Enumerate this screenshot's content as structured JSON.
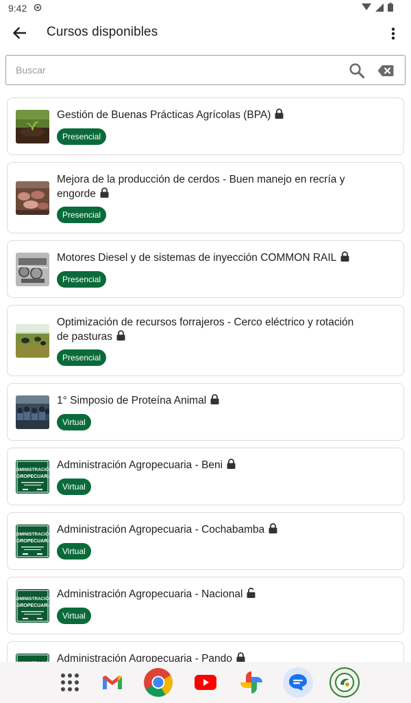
{
  "status_bar": {
    "time": "9:42"
  },
  "app_bar": {
    "title": "Cursos disponibles"
  },
  "search": {
    "placeholder": "Buscar",
    "value": ""
  },
  "courses": [
    {
      "title": "Gestión de Buenas Prácticas Agrícolas (BPA)",
      "modality": "Presencial",
      "locked": true,
      "thumb": "soil-seedling"
    },
    {
      "title": "Mejora de la producción de cerdos - Buen manejo en recría y engorde",
      "modality": "Presencial",
      "locked": true,
      "thumb": "pigs"
    },
    {
      "title": "Motores Diesel y de sistemas de inyección COMMON RAIL",
      "modality": "Presencial",
      "locked": true,
      "thumb": "engine"
    },
    {
      "title": "Optimización de recursos forrajeros - Cerco eléctrico y rotación de pasturas",
      "modality": "Presencial",
      "locked": true,
      "thumb": "pasture-cattle"
    },
    {
      "title": "1° Simposio de Proteína Animal",
      "modality": "Virtual",
      "locked": true,
      "thumb": "audience"
    },
    {
      "title": "Administración Agropecuaria - Beni",
      "modality": "Virtual",
      "locked": true,
      "thumb": "admin-agro"
    },
    {
      "title": "Administración Agropecuaria - Cochabamba",
      "modality": "Virtual",
      "locked": true,
      "thumb": "admin-agro"
    },
    {
      "title": "Administración Agropecuaria - Nacional",
      "modality": "Virtual",
      "locked": false,
      "thumb": "admin-agro"
    },
    {
      "title": "Administración Agropecuaria - Pando",
      "modality": "Virtual",
      "locked": true,
      "thumb": "admin-agro"
    }
  ],
  "thumb_text": {
    "line1": "ADMINISTRACIÓN",
    "line2": "AGROPECUARIA"
  },
  "dock": {
    "apps": [
      "app-drawer",
      "gmail",
      "chrome",
      "youtube",
      "photos",
      "messages",
      "course-app"
    ]
  },
  "colors": {
    "badge": "#0a6b3a",
    "card_border": "#dcdcdc",
    "dock_bg": "#f6f4f4"
  }
}
